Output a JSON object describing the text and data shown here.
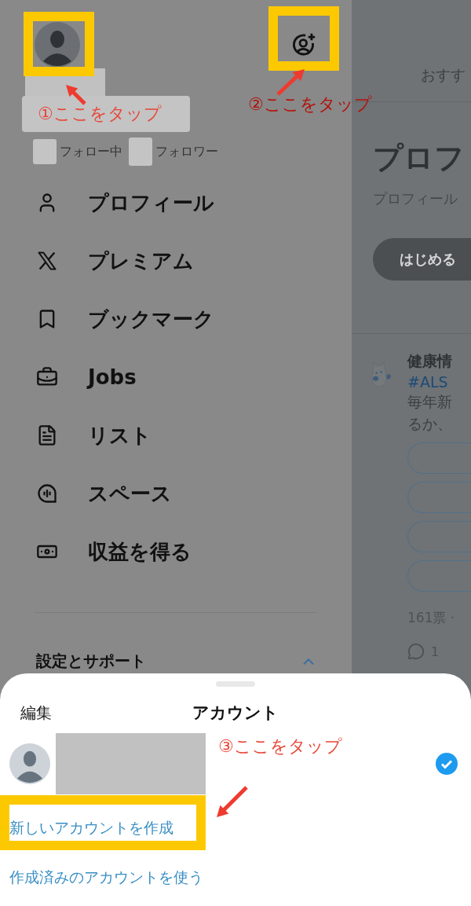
{
  "drawer": {
    "follow_counts": [
      {
        "label": "フォロー中"
      },
      {
        "label": "フォロワー"
      }
    ],
    "menu": [
      {
        "label": "プロフィール"
      },
      {
        "label": "プレミアム"
      },
      {
        "label": "ブックマーク"
      },
      {
        "label": "Jobs"
      },
      {
        "label": "リスト"
      },
      {
        "label": "スペース"
      },
      {
        "label": "収益を得る"
      }
    ],
    "settings": {
      "label": "設定とサポート"
    }
  },
  "feed": {
    "tab": "おすす",
    "title": "プロフ",
    "subtitle": "プロフィール",
    "button": "はじめる",
    "post": {
      "author": "健康情",
      "hashtag": "#ALS",
      "lines": [
        "毎年新",
        "るか、"
      ],
      "votes": "161票 ·",
      "replies": "1"
    }
  },
  "annotations": [
    {
      "label": "①ここをタップ"
    },
    {
      "label": "②ここをタップ"
    },
    {
      "label": "③ここをタップ"
    }
  ],
  "sheet": {
    "edit": "編集",
    "title": "アカウント",
    "accounts": [
      {
        "selected": true
      }
    ],
    "links": [
      "新しいアカウントを作成",
      "作成済みのアカウントを使う"
    ]
  }
}
